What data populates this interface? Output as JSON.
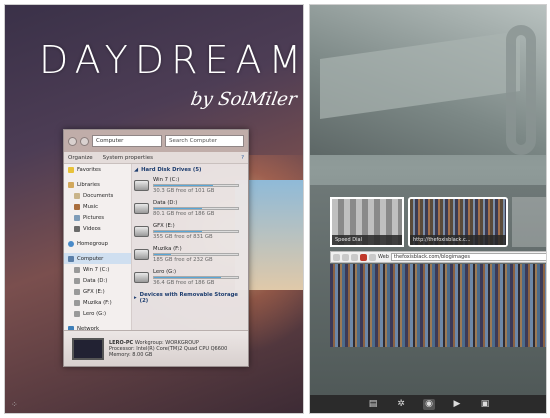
{
  "wallpaper": {
    "title": "DAYDREAM",
    "byline": "by SolMiler"
  },
  "explorer": {
    "address": "Computer",
    "search_placeholder": "Search Computer",
    "toolbar": {
      "organize": "Organize",
      "system_properties": "System properties"
    },
    "nav": {
      "favorites": "Favorites",
      "libraries": "Libraries",
      "library_items": [
        "Documents",
        "Music",
        "Pictures",
        "Videos"
      ],
      "homegroup": "Homegroup",
      "computer": "Computer",
      "drives": [
        "Win 7 (C:)",
        "Data (D:)",
        "GFX (E:)",
        "Muzika (F:)",
        "Lero (G:)"
      ],
      "network": "Network"
    },
    "hdd_group": "Hard Disk Drives (5)",
    "drives": [
      {
        "name": "Win 7 (C:)",
        "free": "30.3 GB free of 101 GB",
        "used_fraction": 0.7
      },
      {
        "name": "Data (D:)",
        "free": "80.1 GB free of 186 GB",
        "used_fraction": 0.57
      },
      {
        "name": "GFX (E:)",
        "free": "355 GB free of 831 GB",
        "used_fraction": 0.57
      },
      {
        "name": "Muzika (F:)",
        "free": "185 GB free of 232 GB",
        "used_fraction": 0.2
      },
      {
        "name": "Lero (G:)",
        "free": "36.4 GB free of 186 GB",
        "used_fraction": 0.8
      }
    ],
    "removable_group": "Devices with Removable Storage (2)",
    "details": {
      "pc_name": "LERO-PC",
      "workgroup": "Workgroup: WORKGROUP",
      "processor": "Processor: Intel(R) Core(TM)2 Quad CPU",
      "cpu_model": "Q6600",
      "memory": "Memory: 8.00 GB"
    }
  },
  "browser": {
    "tab1_label": "Speed Dial",
    "tab2_label": "http://thefoxisblack.c...",
    "url": "thefoxisblack.com/blogimages",
    "web_label": "Web"
  },
  "colors": {
    "accent": "#59a6d6",
    "taskbar": "#2b2b2b"
  }
}
